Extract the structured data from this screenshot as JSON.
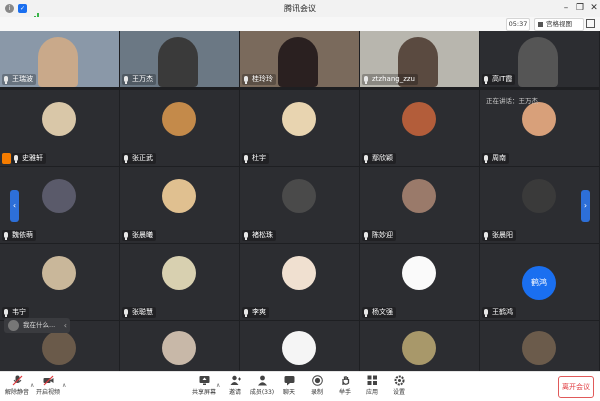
{
  "window": {
    "title": "腾讯会议",
    "controls": [
      "minimize-icon",
      "restore-icon",
      "close-icon"
    ]
  },
  "info_bar": {
    "timer": "05:37",
    "view_label": "宫格视图",
    "speaking_text": "正在讲话：王万杰"
  },
  "participants": [
    {
      "name": "王瑞波",
      "type": "camera"
    },
    {
      "name": "王万杰",
      "type": "camera"
    },
    {
      "name": "桂玲玲",
      "type": "camera"
    },
    {
      "name": "ztzhang_zzu",
      "type": "camera"
    },
    {
      "name": "高IT霞",
      "type": "camera"
    },
    {
      "name": "史雅轩",
      "type": "avatar",
      "badge": "host"
    },
    {
      "name": "张正武",
      "type": "avatar"
    },
    {
      "name": "杜宇",
      "type": "avatar"
    },
    {
      "name": "鄢欣颖",
      "type": "avatar"
    },
    {
      "name": "周南",
      "type": "avatar"
    },
    {
      "name": "魏依萌",
      "type": "avatar"
    },
    {
      "name": "张晨曦",
      "type": "avatar"
    },
    {
      "name": "褚松珠",
      "type": "avatar"
    },
    {
      "name": "陈妙迎",
      "type": "avatar"
    },
    {
      "name": "张晨阳",
      "type": "avatar"
    },
    {
      "name": "韦宁",
      "type": "avatar"
    },
    {
      "name": "张聪慧",
      "type": "avatar"
    },
    {
      "name": "李爽",
      "type": "avatar"
    },
    {
      "name": "杨文强",
      "type": "avatar"
    },
    {
      "name": "王鹤鸿",
      "type": "initials",
      "initials": "鹤鸿",
      "color": "#1a6ff0"
    },
    {
      "name": "",
      "type": "avatar"
    },
    {
      "name": "",
      "type": "avatar"
    },
    {
      "name": "",
      "type": "avatar"
    },
    {
      "name": "",
      "type": "avatar"
    },
    {
      "name": "",
      "type": "avatar"
    }
  ],
  "floating_panel": {
    "text": "我在什么..."
  },
  "toolbar": {
    "items": [
      {
        "label": "解除静音",
        "icon": "mic-muted-icon"
      },
      {
        "label": "开启视频",
        "icon": "video-off-icon"
      },
      {
        "label": "共享屏幕",
        "icon": "share-screen-icon"
      },
      {
        "label": "邀请",
        "icon": "invite-icon"
      },
      {
        "label": "成员(33)",
        "icon": "members-icon"
      },
      {
        "label": "聊天",
        "icon": "chat-icon"
      },
      {
        "label": "录制",
        "icon": "record-icon"
      },
      {
        "label": "举手",
        "icon": "raise-hand-icon"
      },
      {
        "label": "应用",
        "icon": "apps-icon"
      },
      {
        "label": "设置",
        "icon": "settings-icon"
      }
    ],
    "end_label": "离开会议"
  },
  "colors": {
    "accent": "#1a6ff0",
    "danger": "#e0393e",
    "host_badge": "#f57c00",
    "grid_bg": "#1e1f22",
    "tile_bg": "#2c2d31"
  }
}
